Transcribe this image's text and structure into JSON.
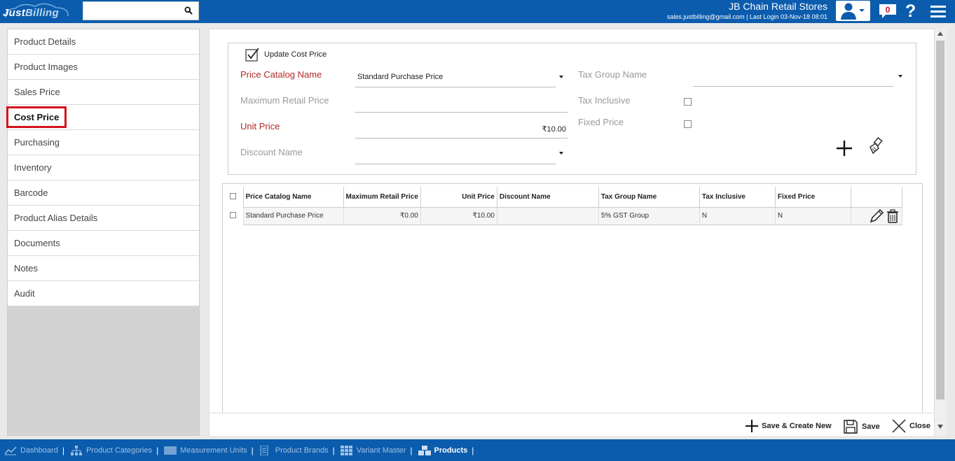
{
  "header": {
    "logo_text_a": "Just",
    "logo_text_b": "Billing",
    "search_value": "",
    "store_name": "JB Chain Retail Stores",
    "store_sub": "sales.justbilling@gmail.com | Last Login 03-Nov-18 08:01",
    "notification_count": "0",
    "help_label": "?"
  },
  "sidebar": {
    "items": [
      {
        "label": "Product Details"
      },
      {
        "label": "Product Images"
      },
      {
        "label": "Sales Price"
      },
      {
        "label": "Cost Price"
      },
      {
        "label": "Purchasing"
      },
      {
        "label": "Inventory"
      },
      {
        "label": "Barcode"
      },
      {
        "label": "Product Alias Details"
      },
      {
        "label": "Documents"
      },
      {
        "label": "Notes"
      },
      {
        "label": "Audit"
      }
    ],
    "active_index": 3
  },
  "form": {
    "update_cost_price_label": "Update Cost Price",
    "update_cost_price_checked": true,
    "price_catalog_label": "Price Catalog Name",
    "price_catalog_value": "Standard Purchase Price",
    "mrp_label": "Maximum Retail Price",
    "mrp_value": "",
    "unit_price_label": "Unit Price",
    "unit_price_value": "₹10.00",
    "discount_label": "Discount Name",
    "discount_value": "",
    "tax_group_label": "Tax Group Name",
    "tax_group_value": "",
    "tax_inclusive_label": "Tax Inclusive",
    "tax_inclusive_checked": false,
    "fixed_price_label": "Fixed Price",
    "fixed_price_checked": false
  },
  "table": {
    "columns": [
      "Price Catalog Name",
      "Maximum Retail Price",
      "Unit Price",
      "Discount Name",
      "Tax Group Name",
      "Tax Inclusive",
      "Fixed Price"
    ],
    "rows": [
      {
        "catalog": "Standard Purchase Price",
        "mrp": "₹0.00",
        "unit_price": "₹10.00",
        "discount": "",
        "tax_group": "5% GST Group",
        "tax_inclusive": "N",
        "fixed_price": "N"
      }
    ]
  },
  "actions": {
    "save_create_new": "Save & Create New",
    "save": "Save",
    "close": "Close"
  },
  "taskbar": {
    "items": [
      {
        "label": "Dashboard",
        "icon": "chart-icon"
      },
      {
        "label": "Product Categories",
        "icon": "hierarchy-icon"
      },
      {
        "label": "Measurement Units",
        "icon": "ruler-icon"
      },
      {
        "label": "Product Brands",
        "icon": "brand-icon"
      },
      {
        "label": "Variant Master",
        "icon": "grid-icon"
      },
      {
        "label": "Products",
        "icon": "boxes-icon"
      }
    ]
  }
}
